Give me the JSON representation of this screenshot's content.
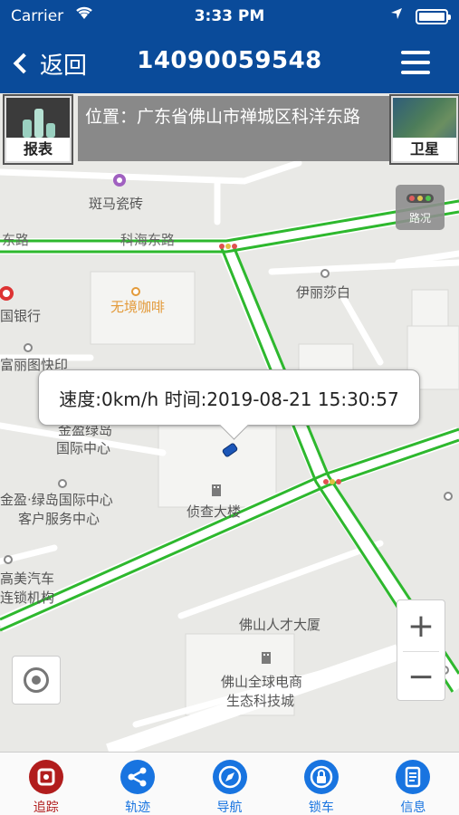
{
  "status_bar": {
    "carrier": "Carrier",
    "time": "3:33 PM"
  },
  "nav": {
    "back_label": "返回",
    "title": "14090059548"
  },
  "toolbar": {
    "report_label": "报表",
    "address": "位置：广东省佛山市禅城区科洋东路",
    "satellite_label": "卫星",
    "traffic_label": "路况"
  },
  "map": {
    "pois": {
      "banma": "斑马瓷砖",
      "kehai_road": "科海东路",
      "road_left": "东路",
      "wujing": "无境咖啡",
      "yilisha": "伊丽莎白",
      "bank": "国银行",
      "fuli": "富丽图快印",
      "jinying1": "金盈绿岛",
      "jinying2": "国际中心",
      "jinying_cs1": "金盈·绿岛国际中心",
      "jinying_cs2": "客户服务中心",
      "zhencha": "侦查大楼",
      "meiqiche1": "高美汽车",
      "meiqiche2": "连锁机构",
      "rencai": "佛山人才大厦",
      "quanqiu1": "佛山全球电商",
      "quanqiu2": "生态科技城"
    },
    "callout": "速度:0km/h 时间:2019-08-21 15:30:57",
    "zoom_in": "+",
    "zoom_out": "−"
  },
  "tabs": [
    {
      "label": "追踪",
      "icon": "track-icon",
      "active": true
    },
    {
      "label": "轨迹",
      "icon": "share-icon",
      "active": false
    },
    {
      "label": "导航",
      "icon": "compass-icon",
      "active": false
    },
    {
      "label": "锁车",
      "icon": "lock-car-icon",
      "active": false
    },
    {
      "label": "信息",
      "icon": "info-doc-icon",
      "active": false
    }
  ],
  "colors": {
    "nav_blue": "#0a4b9a",
    "route_green": "#2eb82e",
    "active_red": "#b11d1d",
    "tab_blue": "#1874e0"
  }
}
